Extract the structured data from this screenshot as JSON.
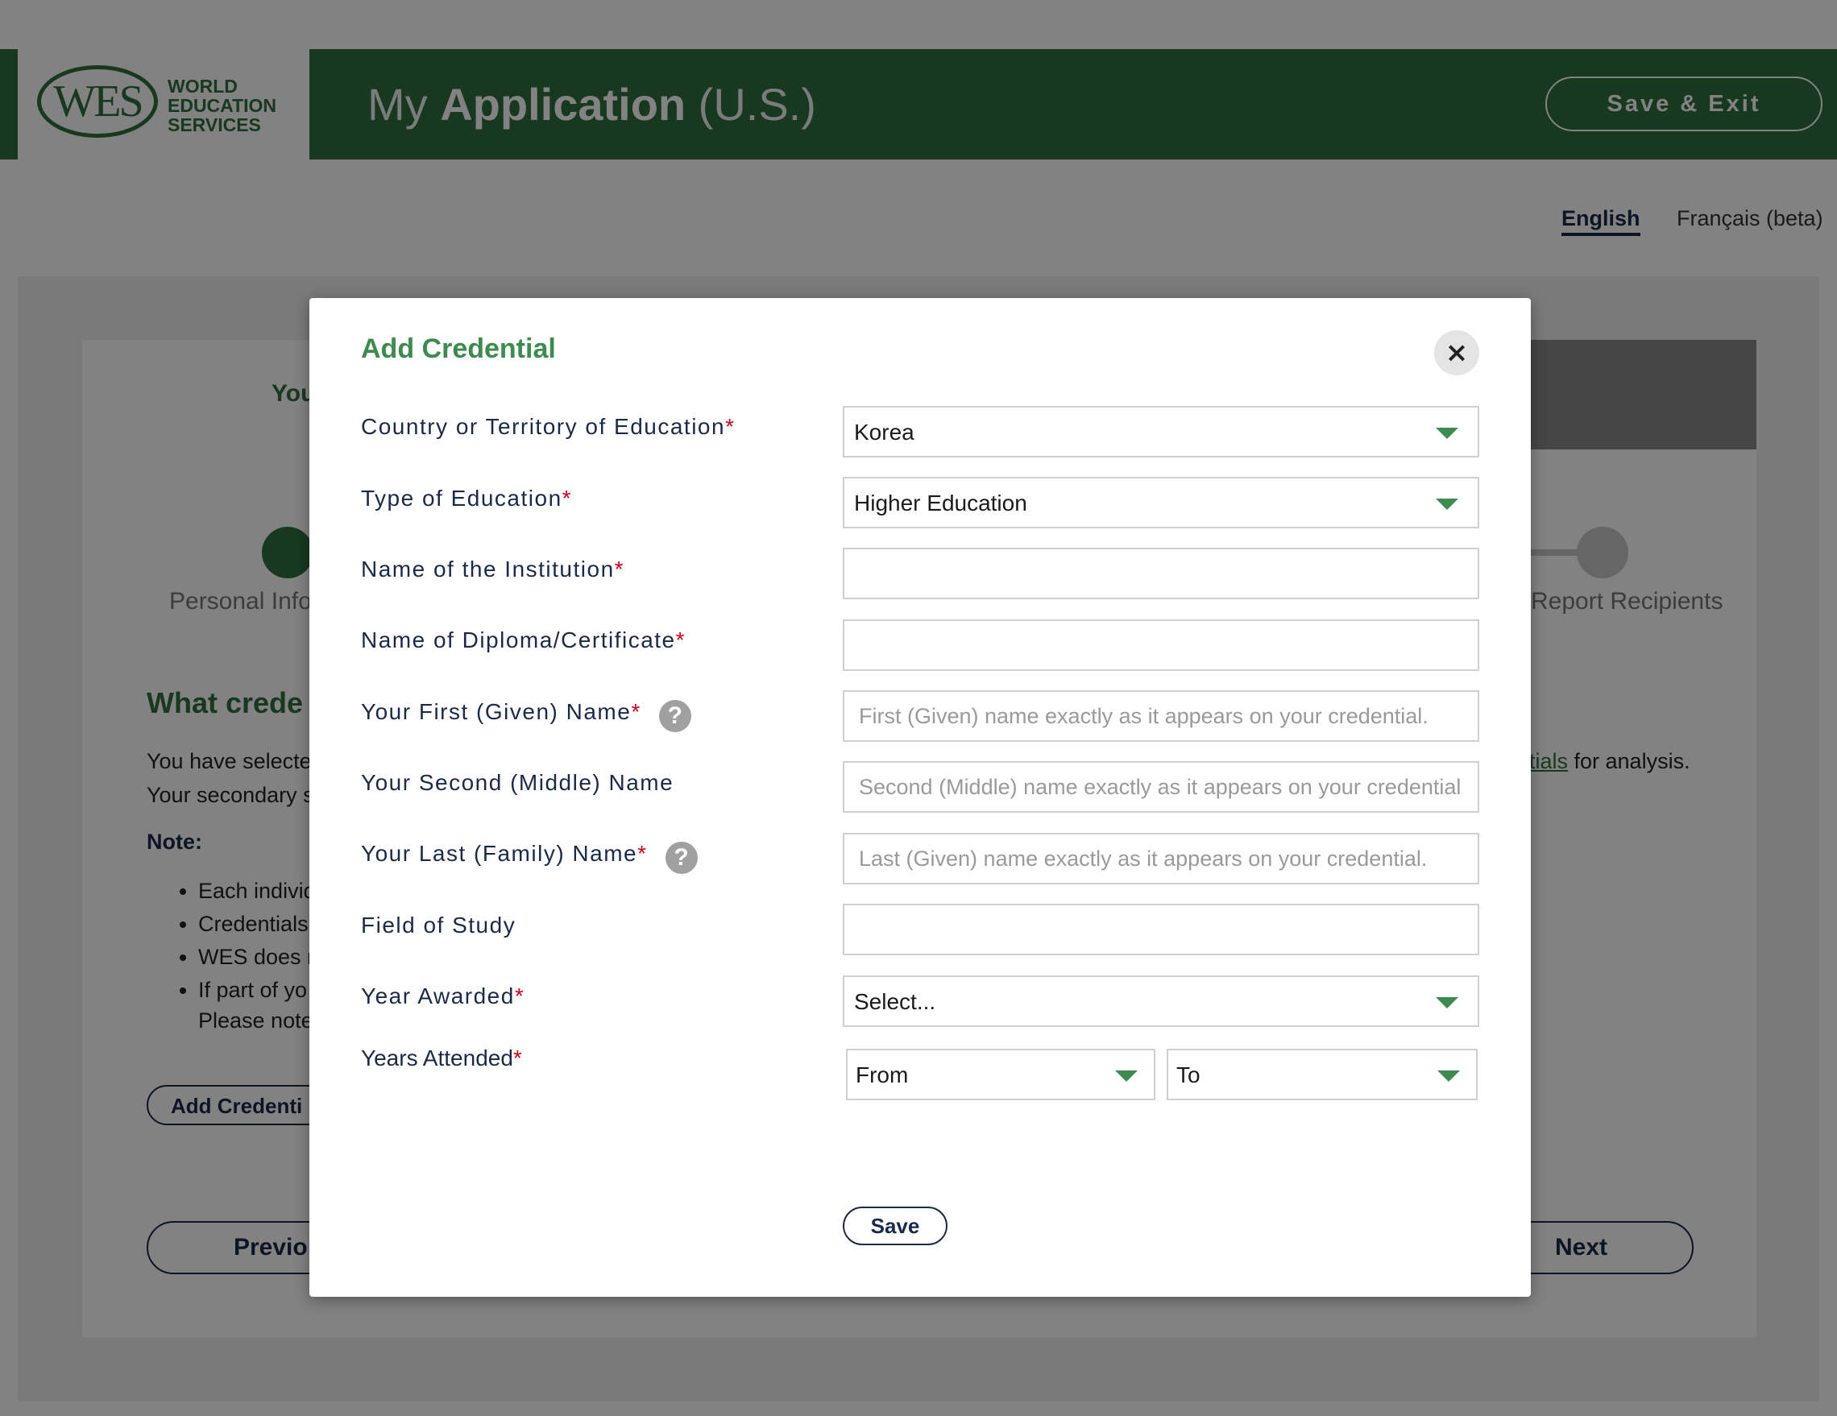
{
  "header": {
    "logo_mark": "WES",
    "logo_text": [
      "WORLD",
      "EDUCATION",
      "SERVICES"
    ],
    "title_prefix": "My",
    "title_main": "Application",
    "title_suffix": "(U.S.)",
    "save_exit_label": "Save & Exit"
  },
  "languages": {
    "english": "English",
    "french": "Français (beta)"
  },
  "background": {
    "you_partial": "You",
    "step_personal": "Personal Info",
    "step_recipients": "Report Recipients",
    "heading_partial": "What crede",
    "line1_partial": "You have selecte",
    "line1_link": "tials",
    "line1_end": " for analysis.",
    "line2_partial": "Your secondary s",
    "note_label": "Note:",
    "bullets": [
      "Each individ",
      "Credentials",
      "WES does n",
      "If part of yo"
    ],
    "please_note_partial": "Please note",
    "add_credential_partial": "Add Credenti",
    "previous_partial": "Previo",
    "next_label": "Next"
  },
  "modal": {
    "title": "Add Credential",
    "close_glyph": "×",
    "save_label": "Save",
    "fields": {
      "country": {
        "label": "Country or Territory of Education",
        "value": "Korea"
      },
      "education_type": {
        "label": "Type of Education",
        "value": "Higher Education"
      },
      "institution": {
        "label": "Name of the Institution",
        "value": ""
      },
      "diploma": {
        "label": "Name of Diploma/Certificate",
        "value": ""
      },
      "first_name": {
        "label": "Your First (Given) Name",
        "placeholder": "First (Given) name exactly as it appears on your credential."
      },
      "middle_name": {
        "label": "Your Second (Middle) Name",
        "placeholder": "Second (Middle) name exactly as it appears on your credential."
      },
      "last_name": {
        "label": "Your Last (Family) Name",
        "placeholder": "Last (Given) name exactly as it appears on your credential."
      },
      "field_of_study": {
        "label": "Field of Study",
        "value": ""
      },
      "year_awarded": {
        "label": "Year Awarded",
        "value": "Select..."
      },
      "years_attended": {
        "label": "Years Attended",
        "from": "From",
        "to": "To"
      }
    },
    "help_glyph": "?",
    "required_mark": "*"
  },
  "colors": {
    "brand_green": "#2f6e3e",
    "accent_green": "#3d8b4f",
    "navy": "#1b2a4a",
    "required_red": "#d0021b"
  }
}
